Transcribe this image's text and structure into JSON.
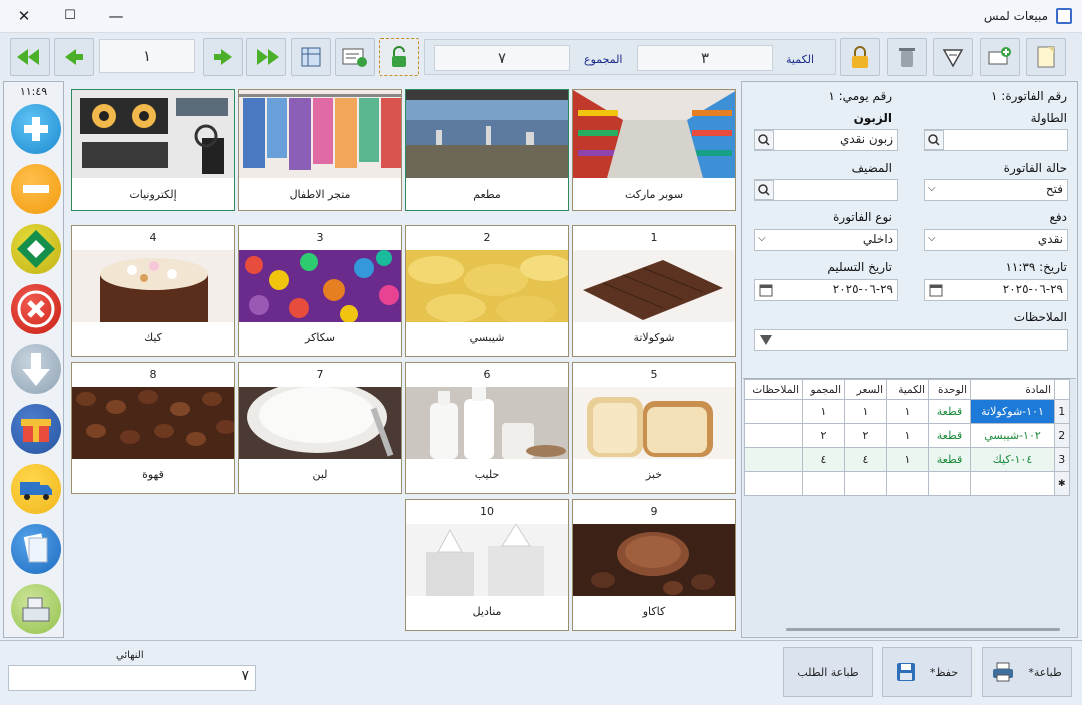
{
  "window": {
    "title": "مبيعات لمس",
    "close": "✕",
    "maximize": "☐",
    "minimize": "—"
  },
  "toolbar": {
    "page_number": "١",
    "quantity_label": "الكمية",
    "quantity_value": "٣",
    "total_label": "المجموع",
    "total_value": "٧"
  },
  "sidebar": {
    "clock": "١١:٤٩"
  },
  "categories": [
    {
      "name": "سوبر ماركت"
    },
    {
      "name": "مطعم"
    },
    {
      "name": "متجر الاطفال"
    },
    {
      "name": "إلكترونيات"
    }
  ],
  "products": [
    {
      "no": "1",
      "name": "شوكولاتة"
    },
    {
      "no": "2",
      "name": "شيبسي"
    },
    {
      "no": "3",
      "name": "سكاكر"
    },
    {
      "no": "4",
      "name": "كيك"
    },
    {
      "no": "5",
      "name": "خبز"
    },
    {
      "no": "6",
      "name": "حليب"
    },
    {
      "no": "7",
      "name": "لبن"
    },
    {
      "no": "8",
      "name": "قهوة"
    },
    {
      "no": "9",
      "name": "كاكاو"
    },
    {
      "no": "10",
      "name": "مناديل"
    }
  ],
  "invoice": {
    "invoice_no": "رقم الفاتورة: ١",
    "daily_no": "رقم يومي: ١",
    "table_label": "الطاولة",
    "customer_label": "الزبون",
    "customer_value": "زبون نقدي",
    "status_label": "حالة الفاتورة",
    "status_value": "فتح",
    "host_label": "المضيف",
    "payment_label": "دفع",
    "payment_value": "نقدي",
    "type_label": "نوع الفاتورة",
    "type_value": "داخلي",
    "date_label": "تاريخ: ١١:٣٩",
    "date_value": "٢٩-٠٦-٢٠٢٥",
    "delivery_label": "تاريخ التسليم",
    "delivery_value": "٢٩-٠٦-٢٠٢٥",
    "notes_label": "الملاحظات"
  },
  "grid": {
    "headers": [
      "المادة",
      "الوحدة",
      "الكمية",
      "السعر",
      "المجمو",
      "الملاحظات"
    ],
    "rows": [
      {
        "idx": "1",
        "item": "١٠١-شوكولاتة",
        "unit": "قطعة",
        "qty": "١",
        "price": "١",
        "total": "١",
        "notes": ""
      },
      {
        "idx": "2",
        "item": "١٠٢-شيبسي",
        "unit": "قطعة",
        "qty": "١",
        "price": "٢",
        "total": "٢",
        "notes": ""
      },
      {
        "idx": "3",
        "item": "١٠٤-كيك",
        "unit": "قطعة",
        "qty": "١",
        "price": "٤",
        "total": "٤",
        "notes": ""
      }
    ]
  },
  "bottom": {
    "final_label": "النهائي",
    "final_value": "٧",
    "print_order": "طباعة الطلب",
    "save": "حفظ*",
    "print": "طباعة*"
  }
}
